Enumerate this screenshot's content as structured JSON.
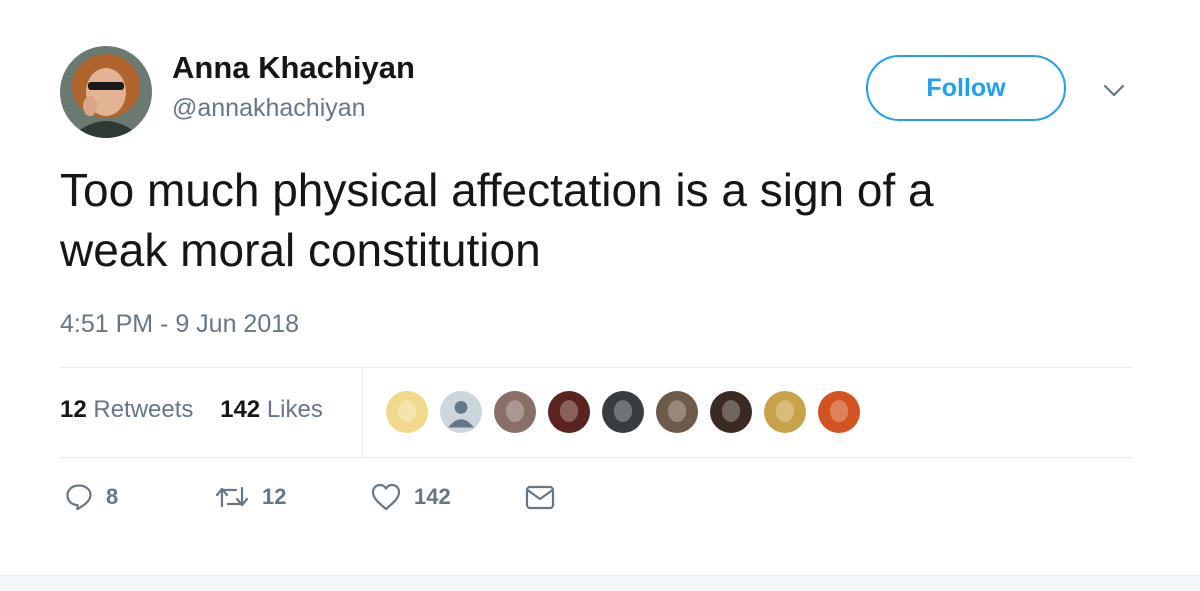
{
  "author": {
    "name": "Anna Khachiyan",
    "handle": "@annakhachiyan"
  },
  "follow_button": {
    "label": "Follow"
  },
  "tweet": {
    "text_line1": "Too much physical affectation is a sign of a",
    "text_line2": "weak moral constitution",
    "timestamp": "4:51 PM - 9 Jun 2018"
  },
  "stats": {
    "retweets_count": "12",
    "retweets_label": "Retweets",
    "likes_count": "142",
    "likes_label": "Likes"
  },
  "likers": [
    {
      "icon": "liker-avatar",
      "color": "#f0d98a"
    },
    {
      "icon": "default-avatar",
      "color": "#ccd6dd"
    },
    {
      "icon": "liker-avatar",
      "color": "#8a6f66"
    },
    {
      "icon": "liker-avatar",
      "color": "#5a2320"
    },
    {
      "icon": "liker-avatar",
      "color": "#3a3d40"
    },
    {
      "icon": "liker-avatar",
      "color": "#6e5a4a"
    },
    {
      "icon": "liker-avatar",
      "color": "#3b2a22"
    },
    {
      "icon": "liker-avatar",
      "color": "#c8a24a"
    },
    {
      "icon": "liker-avatar",
      "color": "#d2531f"
    }
  ],
  "actions": {
    "reply_count": "8",
    "retweet_count": "12",
    "like_count": "142"
  },
  "colors": {
    "accent": "#1da1f2",
    "muted": "#657786",
    "text": "#14171a"
  }
}
